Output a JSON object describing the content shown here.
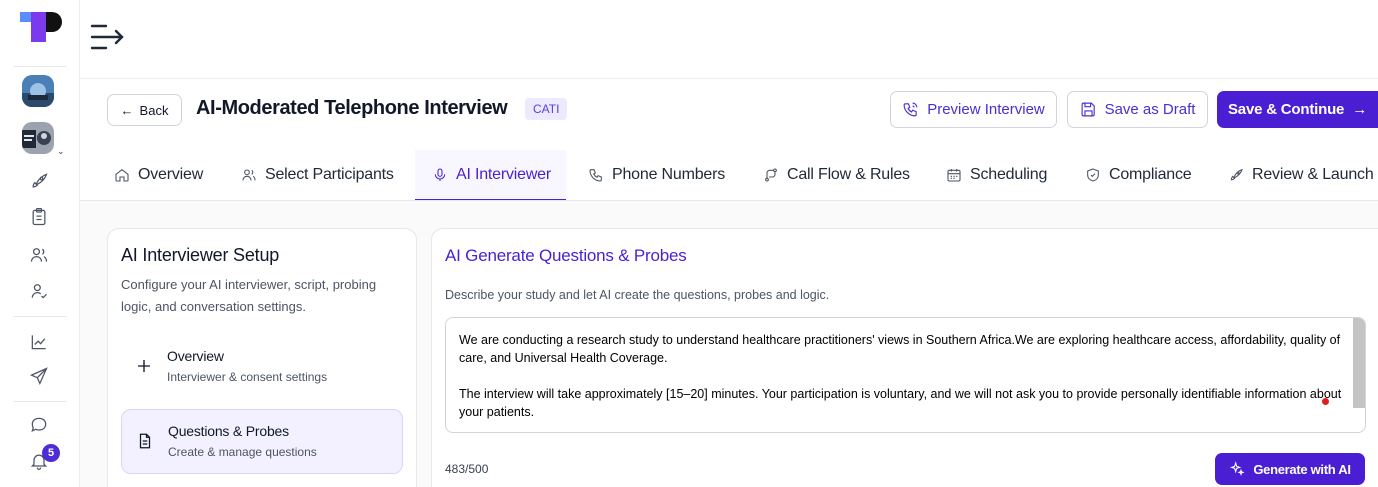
{
  "header": {
    "back_label": "Back",
    "title": "AI-Moderated Telephone Interview",
    "badge": "CATI",
    "preview_label": "Preview Interview",
    "draft_label": "Save as Draft",
    "continue_label": "Save & Continue"
  },
  "tabs": [
    {
      "label": "Overview",
      "icon": "home-icon"
    },
    {
      "label": "Select Participants",
      "icon": "users-icon"
    },
    {
      "label": "AI Interviewer",
      "icon": "mic-icon",
      "active": true
    },
    {
      "label": "Phone Numbers",
      "icon": "phone-icon"
    },
    {
      "label": "Call Flow & Rules",
      "icon": "flow-icon"
    },
    {
      "label": "Scheduling",
      "icon": "calendar-icon"
    },
    {
      "label": "Compliance",
      "icon": "shield-check-icon"
    },
    {
      "label": "Review & Launch",
      "icon": "rocket-icon"
    }
  ],
  "setup": {
    "title": "AI Interviewer Setup",
    "description": "Configure your AI interviewer, script, probing logic, and conversation settings.",
    "items": [
      {
        "label": "Overview",
        "sub": "Interviewer & consent settings",
        "icon": "plus-icon"
      },
      {
        "label": "Questions & Probes",
        "sub": "Create & manage questions",
        "icon": "document-icon",
        "active": true
      }
    ]
  },
  "generator": {
    "title": "AI Generate Questions & Probes",
    "description": "Describe your study and let AI create the questions, probes and logic.",
    "paragraph1": "We are conducting a research study to understand healthcare practitioners' views in Southern Africa.We are exploring healthcare access, affordability, quality of care, and Universal Health Coverage.",
    "paragraph2": "The interview will take approximately [15–20] minutes. Your participation is voluntary, and we will not ask you to provide personally identifiable information about your patients.",
    "counter": "483/500",
    "button_label": "Generate with AI"
  },
  "notifications": {
    "count": "5"
  },
  "colors": {
    "brand": "#4a1fd4",
    "badge_bg": "#ede9fe"
  }
}
